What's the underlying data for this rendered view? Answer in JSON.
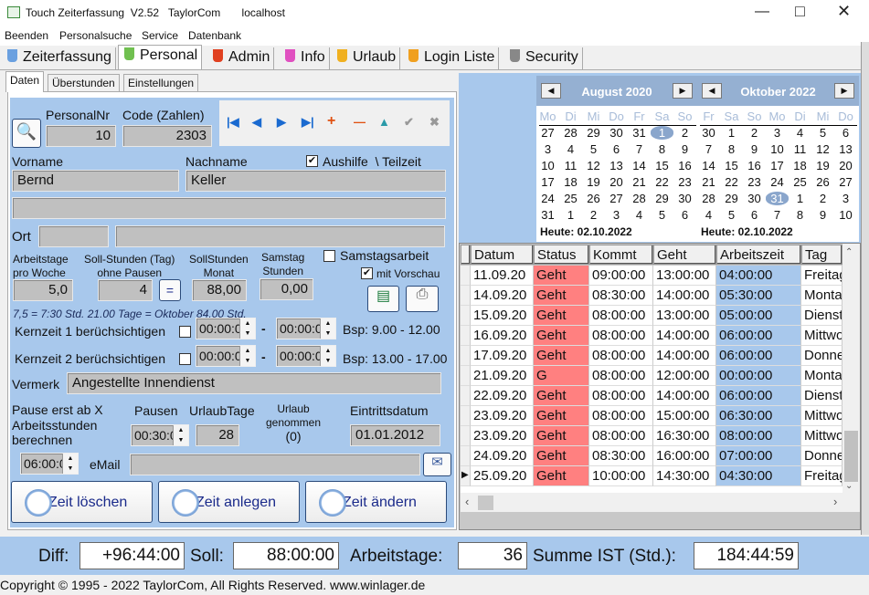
{
  "window": {
    "title": "Touch Zeiterfassung  V2.52   TaylorCom       localhost"
  },
  "menu": [
    "Beenden",
    "Personalsuche",
    "Service",
    "Datenbank"
  ],
  "tabs": [
    {
      "label": "Zeiterfassung",
      "color": "#6aa0e0"
    },
    {
      "label": "Personal",
      "color": "#70c050"
    },
    {
      "label": "Admin",
      "color": "#e04020"
    },
    {
      "label": "Info",
      "color": "#e050c0"
    },
    {
      "label": "Urlaub",
      "color": "#f0b020"
    },
    {
      "label": "Login Liste",
      "color": "#f0a020"
    },
    {
      "label": "Security",
      "color": "#888888"
    }
  ],
  "subtabs": [
    "Daten",
    "Überstunden",
    "Einstellungen"
  ],
  "form": {
    "personalnr_label": "PersonalNr",
    "personalnr": "10",
    "code_label": "Code (Zahlen)",
    "code": "2303",
    "vorname_label": "Vorname",
    "vorname": "Bernd",
    "nachname_label": "Nachname",
    "nachname": "Keller",
    "aushilfe_label": "Aushilfe  \\ Teilzeit",
    "aushilfe_checked": true,
    "strasse": "",
    "ort_label": "Ort",
    "plz": "",
    "ort": "",
    "arbeitstage_label1": "Arbeitstage",
    "arbeitstage_label2": "pro Woche",
    "arbeitstage": "5,0",
    "sollstd_tag_label1": "Soll-Stunden (Tag)",
    "sollstd_tag_label2": "ohne Pausen",
    "sollstd_tag": "4",
    "equals_label": "=",
    "sollstd_monat_label1": "SollStunden",
    "sollstd_monat_label2": "Monat",
    "sollstd_monat": "88,00",
    "samstag_label1": "Samstag",
    "samstag_label2": "Stunden",
    "samstag_stunden": "0,00",
    "samstagsarbeit_label": "Samstagsarbeit",
    "samstagsarbeit_checked": false,
    "vorschau_label": "mit Vorschau",
    "vorschau_checked": true,
    "hint": "7,5 = 7:30 Std. 21.00 Tage = Oktober 84.00 Std.",
    "kern1_label": "Kernzeit 1 berüchsichtigen",
    "kern1_from": "00:00:00",
    "kern1_to": "00:00:00",
    "kern1_example": "Bsp: 9.00 - 12.00",
    "kern2_label": "Kernzeit 2 berüchsichtigen",
    "kern2_from": "00:00:00",
    "kern2_to": "00:00:00",
    "kern2_example": "Bsp: 13.00 - 17.00",
    "dash": "-",
    "vermerk_label": "Vermerk",
    "vermerk": "Angestellte Innendienst",
    "pause_ab_label1": "Pause erst ab X",
    "pause_ab_label2": "Arbeitsstunden",
    "pause_ab_label3": "berechnen",
    "pause_ab": "06:00:00",
    "pausen_label": "Pausen",
    "pausen": "00:30:00",
    "urlaubtage_label": "UrlaubTage",
    "urlaubtage": "28",
    "urlaub_gen_label1": "Urlaub",
    "urlaub_gen_label2": "genommen",
    "urlaub_gen": "(0)",
    "eintritt_label": "Eintrittsdatum",
    "eintritt": "01.01.2012",
    "email_label": "eMail",
    "email": ""
  },
  "buttons": {
    "delete": "Zeit löschen",
    "create": "Zeit anlegen",
    "change": "Zeit ändern"
  },
  "calendars": [
    {
      "title": "August 2020",
      "daynames": [
        "Mo",
        "Di",
        "Mi",
        "Do",
        "Fr",
        "Sa",
        "So"
      ],
      "days": [
        "27",
        "28",
        "29",
        "30",
        "31",
        "1",
        "2",
        "3",
        "4",
        "5",
        "6",
        "7",
        "8",
        "9",
        "10",
        "11",
        "12",
        "13",
        "14",
        "15",
        "16",
        "17",
        "18",
        "19",
        "20",
        "21",
        "22",
        "23",
        "24",
        "25",
        "26",
        "27",
        "28",
        "29",
        "30",
        "31",
        "1",
        "2",
        "3",
        "4",
        "5",
        "6"
      ],
      "selected": 5,
      "today": "Heute: 02.10.2022"
    },
    {
      "title": "Oktober 2022",
      "daynames": [
        "Fr",
        "Sa",
        "So",
        "Mo",
        "Di",
        "Mi",
        "Do"
      ],
      "days": [
        "30",
        "1",
        "2",
        "3",
        "4",
        "5",
        "6",
        "7",
        "8",
        "9",
        "10",
        "11",
        "12",
        "13",
        "14",
        "15",
        "16",
        "17",
        "18",
        "19",
        "20",
        "21",
        "22",
        "23",
        "24",
        "25",
        "26",
        "27",
        "28",
        "29",
        "30",
        "31",
        "1",
        "2",
        "3",
        "4",
        "5",
        "6",
        "7",
        "8",
        "9",
        "10"
      ],
      "selected": 31,
      "today": "Heute: 02.10.2022"
    }
  ],
  "table": {
    "columns": [
      "Datum",
      "Status",
      "Kommt",
      "Geht",
      "Arbeitszeit",
      "Tag"
    ],
    "rows": [
      [
        "11.09.20",
        "Geht",
        "09:00:00",
        "13:00:00",
        "04:00:00",
        "Freitag"
      ],
      [
        "14.09.20",
        "Geht",
        "08:30:00",
        "14:00:00",
        "05:30:00",
        "Montag"
      ],
      [
        "15.09.20",
        "Geht",
        "08:00:00",
        "13:00:00",
        "05:00:00",
        "Dienstag"
      ],
      [
        "16.09.20",
        "Geht",
        "08:00:00",
        "14:00:00",
        "06:00:00",
        "Mittwoch"
      ],
      [
        "17.09.20",
        "Geht",
        "08:00:00",
        "14:00:00",
        "06:00:00",
        "Donnerstag"
      ],
      [
        "21.09.20",
        "G",
        "08:00:00",
        "12:00:00",
        "00:00:00",
        "Montag"
      ],
      [
        "22.09.20",
        "Geht",
        "08:00:00",
        "14:00:00",
        "06:00:00",
        "Dienstag"
      ],
      [
        "23.09.20",
        "Geht",
        "08:00:00",
        "15:00:00",
        "06:30:00",
        "Mittwoch"
      ],
      [
        "23.09.20",
        "Geht",
        "08:00:00",
        "16:30:00",
        "08:00:00",
        "Mittwoch"
      ],
      [
        "24.09.20",
        "Geht",
        "08:30:00",
        "16:00:00",
        "07:00:00",
        "Donnerstag"
      ],
      [
        "25.09.20",
        "Geht",
        "10:00:00",
        "14:30:00",
        "04:30:00",
        "Freitag"
      ]
    ],
    "current_row": 10,
    "status_color": "#ff8080",
    "worktime_color": "#a8c8ec"
  },
  "summary": {
    "diff_label": "Diff:",
    "diff": "+96:44:00",
    "soll_label": "Soll:",
    "soll": "88:00:00",
    "tage_label": "Arbeitstage:",
    "tage": "36",
    "ist_label": "Summe IST (Std.):",
    "ist": "184:44:59"
  },
  "footer": "Copyright © 1995 - 2022  TaylorCom, All Rights Reserved.  www.winlager.de"
}
